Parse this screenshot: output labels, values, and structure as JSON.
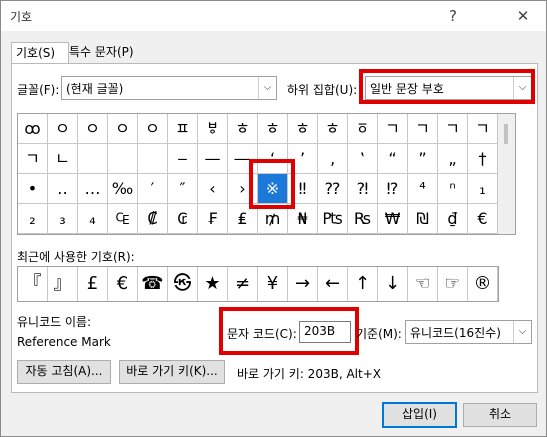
{
  "window": {
    "title": "기호",
    "help": "?",
    "close": "✕"
  },
  "tabs": [
    "기호(S)",
    "특수 문자(P)"
  ],
  "font": {
    "label": "글꼴(F):",
    "value": "(현재 글꼴)"
  },
  "subset": {
    "label": "하위 집합(U):",
    "value": "일반 문장 부호"
  },
  "symbols": [
    [
      "ꝏ",
      "ㅇㅋ",
      "ㅇ",
      "ㅇㅅ",
      "ㅇㅿ",
      "ㅍㅂ",
      "ㅸ",
      "ㅎㄴ",
      "ㅎㄹ",
      "ㅎㅁ",
      "ㅎㅂ",
      "ㆆ",
      "ㄱㄴ",
      "ㄱㅂ",
      "ㄱㅈ",
      "ㄱㅋ"
    ],
    [
      "ㄱㅎ",
      "ㄴㄴ",
      "",
      "",
      "",
      "‒",
      "—",
      "―",
      "‘",
      "’",
      "‚",
      "‛",
      "“",
      "”",
      "„",
      "†",
      "‡"
    ],
    [
      "•",
      "‥",
      "…",
      "‰",
      "′",
      "″",
      "‹",
      "›",
      "※",
      "‼",
      "⁇",
      "⁈",
      "⁉",
      "⁴",
      "ⁿ",
      "₁"
    ],
    [
      "₂",
      "₃",
      "₄",
      "₠",
      "₡",
      "₢",
      "₣",
      "₤",
      "₥",
      "₦",
      "₧",
      "₨",
      "₩",
      "₪",
      "₫",
      "€"
    ]
  ],
  "recent": {
    "label": "최근에 사용한 기호(R):",
    "items": [
      "『",
      "』",
      "£",
      "€",
      "☎",
      "㉿",
      "★",
      "≠",
      "¥",
      "→",
      "←",
      "↑",
      "↓",
      "☜",
      "☞",
      "®"
    ]
  },
  "unicode_name": {
    "label": "유니코드 이름:",
    "value": "Reference Mark"
  },
  "char_code": {
    "label": "문자 코드(C):",
    "value": "203B"
  },
  "from": {
    "label": "기준(M):",
    "value": "유니코드(16진수)"
  },
  "autocorrect_button": "자동 고침(A)...",
  "shortcut_button": "바로 가기 키(K)...",
  "shortcut_text": "바로 가기 키: 203B, Alt+X",
  "insert_button": "삽입(I)",
  "cancel_button": "취소"
}
